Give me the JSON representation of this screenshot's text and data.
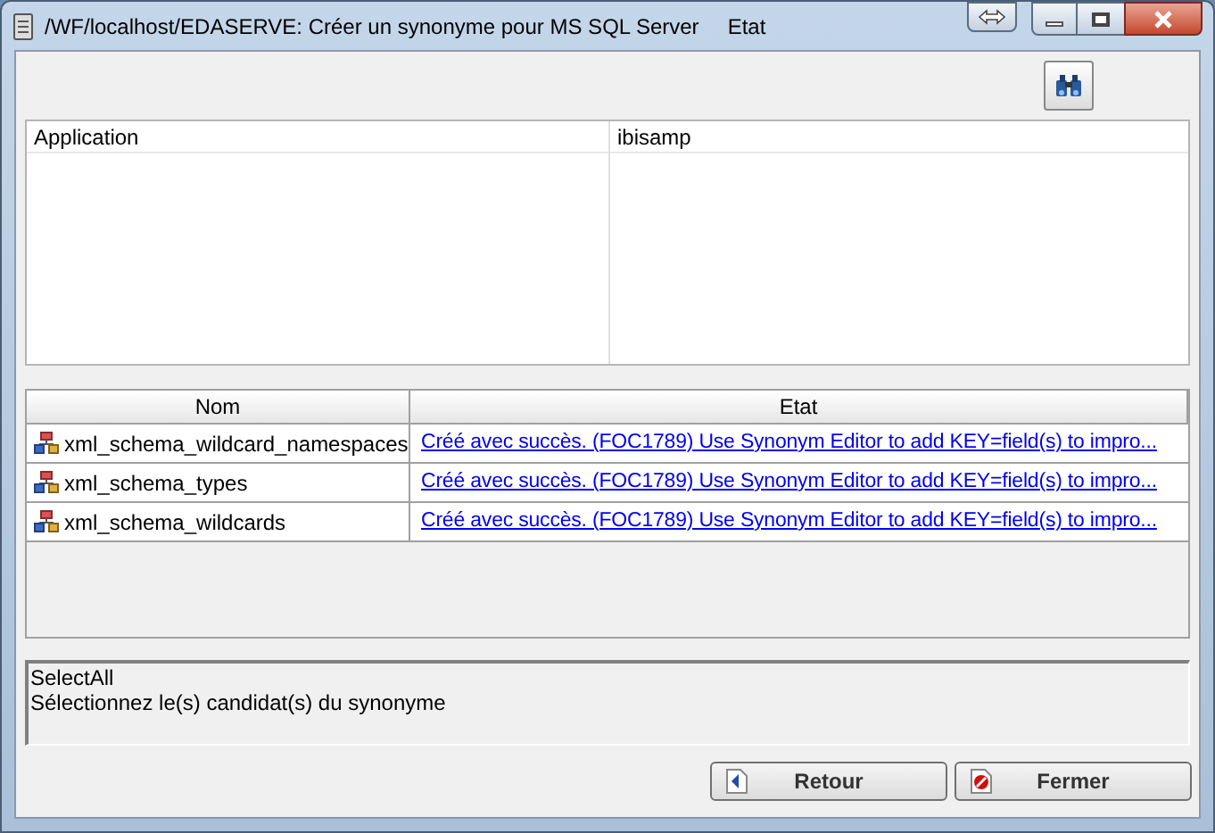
{
  "window": {
    "title": "/WF/localhost/EDASERVE: Créer un synonyme pour MS SQL Server",
    "status": "Etat"
  },
  "properties": {
    "rows": [
      {
        "name": "Application",
        "value": "ibisamp"
      }
    ]
  },
  "table": {
    "columns": [
      "Nom",
      "Etat"
    ],
    "rows": [
      {
        "name": "xml_schema_wildcard_namespaces",
        "status": "Créé avec succès. (FOC1789) Use Synonym Editor to add KEY=field(s) to impro..."
      },
      {
        "name": "xml_schema_types",
        "status": "Créé avec succès. (FOC1789) Use Synonym Editor to add KEY=field(s) to impro..."
      },
      {
        "name": "xml_schema_wildcards",
        "status": "Créé avec succès. (FOC1789) Use Synonym Editor to add KEY=field(s) to impro..."
      }
    ]
  },
  "message": [
    "SelectAll",
    "Sélectionnez le(s) candidat(s) du synonyme"
  ],
  "buttons": [
    {
      "label": "Retour",
      "kind": "back"
    },
    {
      "label": "Fermer",
      "kind": "close"
    }
  ]
}
